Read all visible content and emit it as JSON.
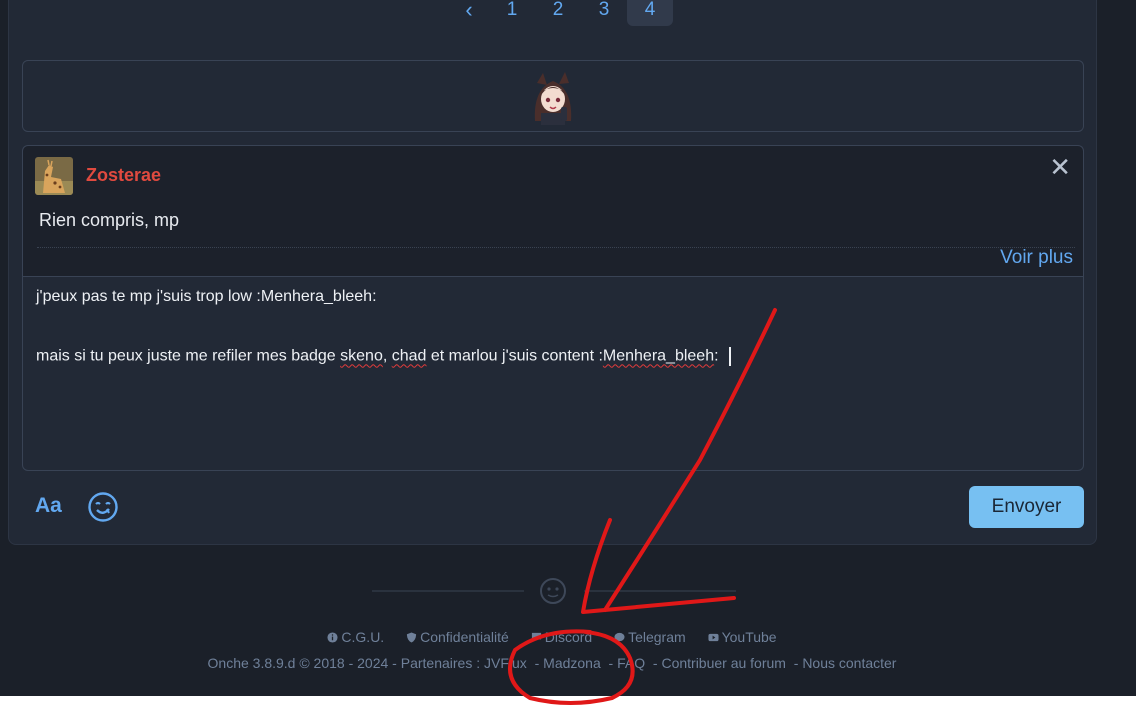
{
  "pagination": {
    "prev_icon": "chevron-left-icon",
    "pages": [
      "1",
      "2",
      "3",
      "4"
    ],
    "active_page": "4"
  },
  "sticker": {
    "name": "menhera-sticker"
  },
  "quote": {
    "author": "Zosterae",
    "author_color": "#e04a3f",
    "text": "Rien compris, mp",
    "close_label": "✕",
    "voir_plus": "Voir plus"
  },
  "editor": {
    "line1": "j'peux pas te mp j'suis trop low :Menhera_bleeh:",
    "line2_a": "mais si tu peux juste me refiler mes badge ",
    "line2_skeno": "skeno",
    "line2_b": ", ",
    "line2_chad": "chad",
    "line2_c": " et marlou j'suis content :",
    "line2_emoji": "Menhera_bleeh",
    "line2_d": ": "
  },
  "toolbar": {
    "format_label": "Aa",
    "send_label": "Envoyer",
    "accent": "#77c0f2"
  },
  "footer": {
    "links": [
      {
        "icon": "info-icon",
        "label": "C.G.U."
      },
      {
        "icon": "shield-icon",
        "label": "Confidentialité"
      },
      {
        "icon": "chat-icon",
        "label": "Discord"
      },
      {
        "icon": "telegram-icon",
        "label": "Telegram"
      },
      {
        "icon": "youtube-icon",
        "label": "YouTube"
      }
    ],
    "version": "Onche 3.8.9.d © 2018 - 2024",
    "partners_label": "Partenaires :",
    "partner1": "JVFlux",
    "partner2": "Madzona",
    "faq": "FAQ",
    "contribute": "Contribuer au forum",
    "contact": "Nous contacter"
  },
  "annotation": {
    "color": "#e01818"
  }
}
